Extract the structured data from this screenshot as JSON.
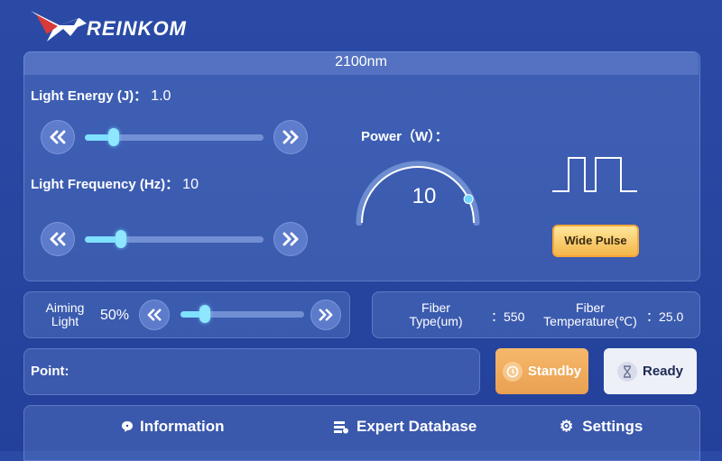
{
  "brand": {
    "name": "REINKOM"
  },
  "wavelength": "2100nm",
  "light_energy": {
    "label": "Light Energy (J)：",
    "value": "1.0",
    "level": 0.16
  },
  "light_frequency": {
    "label": "Light Frequency (Hz)：",
    "value": "10",
    "level": 0.2
  },
  "power": {
    "label": "Power（W）：",
    "value": "10",
    "level": 0.86
  },
  "pulse_button": {
    "label": "Wide Pulse"
  },
  "aiming": {
    "label_line1": "Aiming",
    "label_line2": "Light",
    "value": "50%",
    "level": 0.2
  },
  "fiber_type": {
    "label_line1": "Fiber",
    "label_line2": "Type(um)",
    "value": "：550"
  },
  "fiber_temp": {
    "label_line1": "Fiber",
    "label_line2": "Temperature(℃)",
    "value": "：25.0"
  },
  "point": {
    "label": "Point:"
  },
  "buttons": {
    "standby": "Standby",
    "ready": "Ready"
  },
  "nav": {
    "information": "Information",
    "expert_database": "Expert Database",
    "settings": "Settings"
  },
  "colors": {
    "accent": "#7fe1ff",
    "standby": "#f0a858",
    "pulse": "#f6b84a"
  }
}
